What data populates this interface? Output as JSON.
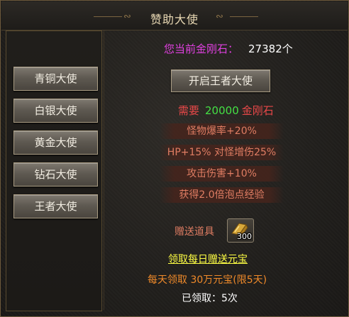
{
  "window": {
    "title": "赞助大使"
  },
  "sidebar": {
    "items": [
      {
        "label": "青铜大使"
      },
      {
        "label": "白银大使"
      },
      {
        "label": "黄金大使"
      },
      {
        "label": "钻石大使"
      },
      {
        "label": "王者大使"
      }
    ]
  },
  "main": {
    "balance_label": "您当前金刚石：",
    "balance_value": "27382个",
    "open_button": "开启王者大使",
    "cost": {
      "prefix": "需要",
      "amount": "20000",
      "unit": "金刚石"
    },
    "bonuses": [
      "怪物爆率+20%",
      "HP+15% 对怪增伤25%",
      "攻击伤害+10%",
      "获得2.0倍泡点经验"
    ],
    "gift_label": "赠送道具",
    "gift_item": {
      "count": "300",
      "icon": "gold-bar-icon"
    },
    "daily_link": "领取每日赠送元宝",
    "daily_desc": "每天领取 30万元宝(限5天)",
    "claimed": "已领取：5次"
  },
  "colors": {
    "title": "#e9d9b4",
    "magenta": "#e040e0",
    "red": "#e84848",
    "green": "#44e044",
    "yellow": "#ffff44",
    "orange": "#f08a2a",
    "bonus_text": "#e07d63"
  }
}
